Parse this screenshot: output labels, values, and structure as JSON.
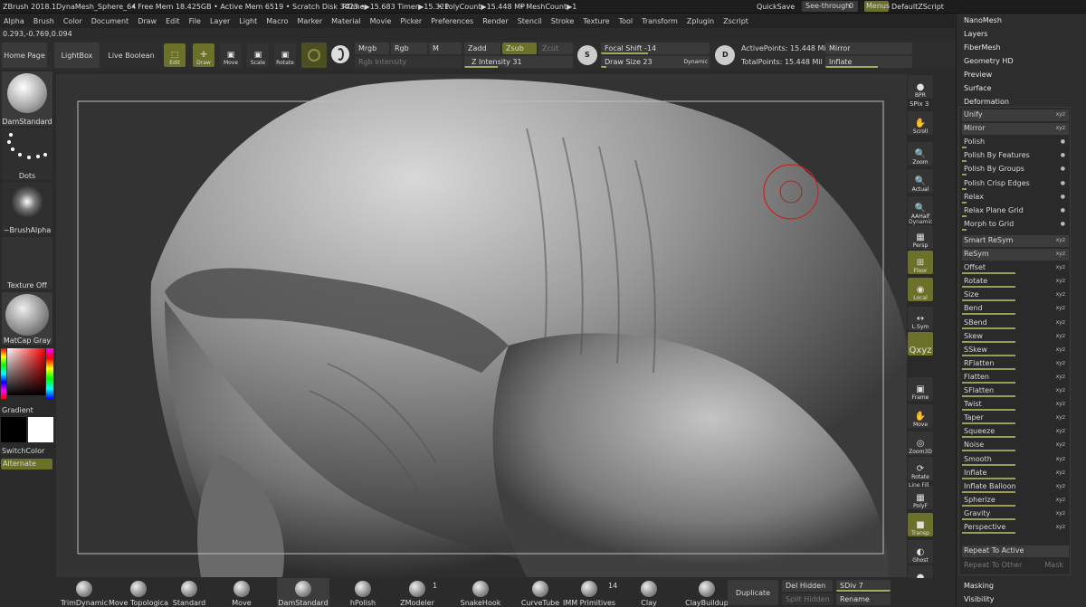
{
  "titlebar": {
    "app": "ZBrush 2018.1",
    "file": "DynaMesh_Sphere_64",
    "stats": "• Free Mem 18.425GB • Active Mem 6519 • Scratch Disk 3423 •",
    "rtime": "RTime▶15.683 Timer▶15.321",
    "polycount": "• PolyCount▶15.448 MP",
    "meshcount": "• MeshCount▶1",
    "quicksave": "QuickSave",
    "seethrough": "See-through",
    "seethrough_val": "0",
    "menus": "Menus",
    "script": "DefaultZScript"
  },
  "menu": [
    "Alpha",
    "Brush",
    "Color",
    "Document",
    "Draw",
    "Edit",
    "File",
    "Layer",
    "Light",
    "Macro",
    "Marker",
    "Material",
    "Movie",
    "Picker",
    "Preferences",
    "Render",
    "Stencil",
    "Stroke",
    "Texture",
    "Tool",
    "Transform",
    "Zplugin",
    "Zscript"
  ],
  "coords": "0.293,-0.769,0.094",
  "shelf": {
    "home": "Home Page",
    "lightbox": "LightBox",
    "liveboolean": "Live Boolean",
    "edit": "Edit",
    "draw": "Draw",
    "move": "Move",
    "scale": "Scale",
    "rotate": "Rotate",
    "mrgb": "Mrgb",
    "rgb": "Rgb",
    "m": "M",
    "rgb_intensity": "Rgb Intensity",
    "zadd": "Zadd",
    "zsub": "Zsub",
    "zcut": "Zcut",
    "z_intensity_label": "Z Intensity",
    "z_intensity": "31",
    "focal_label": "Focal Shift",
    "focal": "-14",
    "drawsize_label": "Draw Size",
    "drawsize": "23",
    "dynamic": "Dynamic",
    "active_points": "ActivePoints: 15.448 Mil",
    "total_points": "TotalPoints: 15.448 Mil",
    "mirror": "Mirror",
    "inflate": "Inflate"
  },
  "left": {
    "brush": "DamStandard",
    "stroke": "Dots",
    "alpha": "~BrushAlpha",
    "texture": "Texture Off",
    "material": "MatCap Gray",
    "gradient": "Gradient",
    "switchcolor": "SwitchColor",
    "alternate": "Alternate"
  },
  "rstrip": [
    {
      "name": "bpr",
      "gl": "●",
      "lb": "BPR"
    },
    {
      "name": "scroll",
      "gl": "✋",
      "lb": "Scroll"
    },
    {
      "name": "zoom",
      "gl": "🔍",
      "lb": "Zoom"
    },
    {
      "name": "actual",
      "gl": "🔍",
      "lb": "Actual"
    },
    {
      "name": "aahalf",
      "gl": "🔍",
      "lb": "AAHalf"
    },
    {
      "name": "persp",
      "gl": "▦",
      "lb": "Persp"
    },
    {
      "name": "floor",
      "gl": "⊞",
      "lb": "Floor"
    },
    {
      "name": "local",
      "gl": "◉",
      "lb": "Local"
    },
    {
      "name": "lsym",
      "gl": "↔",
      "lb": "L.Sym"
    },
    {
      "name": "xyz",
      "gl": "Qxyz",
      "lb": ""
    },
    {
      "name": "frame",
      "gl": "▣",
      "lb": "Frame"
    },
    {
      "name": "move",
      "gl": "✋",
      "lb": "Move"
    },
    {
      "name": "zoom3d",
      "gl": "◎",
      "lb": "Zoom3D"
    },
    {
      "name": "rotate",
      "gl": "⟳",
      "lb": "Rotate"
    },
    {
      "name": "polyf",
      "gl": "▦",
      "lb": "PolyF"
    },
    {
      "name": "transp",
      "gl": "■",
      "lb": "Transp"
    },
    {
      "name": "ghost",
      "gl": "◐",
      "lb": "Ghost"
    },
    {
      "name": "solo",
      "gl": "●",
      "lb": "Solo"
    }
  ],
  "rstrip_spix": "SPix 3",
  "rstrip_dynamic": "Dynamic",
  "rstrip_linefill": "Line Fill",
  "rpanel": {
    "sections": [
      "NanoMesh",
      "Layers",
      "FiberMesh",
      "Geometry HD",
      "Preview",
      "Surface",
      "Deformation"
    ],
    "deform": [
      "Unify",
      "Mirror",
      "Polish",
      "Polish By Features",
      "Polish By Groups",
      "Polish Crisp Edges",
      "Relax",
      "Relax Plane Grid",
      "Morph to Grid",
      "Smart ReSym",
      "ReSym",
      "Offset",
      "Rotate",
      "Size",
      "Bend",
      "SBend",
      "Skew",
      "SSkew",
      "RFlatten",
      "Flatten",
      "SFlatten",
      "Twist",
      "Taper",
      "Squeeze",
      "Noise",
      "Smooth",
      "Inflate",
      "Inflate Balloon",
      "Spherize",
      "Gravity",
      "Perspective"
    ],
    "repeat_active": "Repeat To Active",
    "repeat_other": "Repeat To Other",
    "mask": "Mask",
    "masking": "Masking",
    "visibility": "Visibility"
  },
  "bottom": [
    {
      "label": "TrimDynamic"
    },
    {
      "label": "Move Topologica"
    },
    {
      "label": "Standard"
    },
    {
      "label": "Move"
    },
    {
      "label": "DamStandard"
    },
    {
      "label": "hPolish"
    },
    {
      "label": "ZModeler"
    },
    {
      "label": "SnakeHook"
    },
    {
      "label": "CurveTube"
    },
    {
      "label": "IMM Primitives"
    },
    {
      "label": "Clay"
    },
    {
      "label": "ClayBuildup"
    }
  ],
  "bottom_counts": {
    "zmodeler": "1",
    "imm": "14"
  },
  "bottom_right": {
    "duplicate": "Duplicate",
    "delhidden": "Del Hidden",
    "splithidden": "Split Hidden",
    "sdiv": "SDiv 7",
    "rename": "Rename"
  },
  "colors": {
    "accent": "#6b7128",
    "cursor": "#d02020"
  }
}
